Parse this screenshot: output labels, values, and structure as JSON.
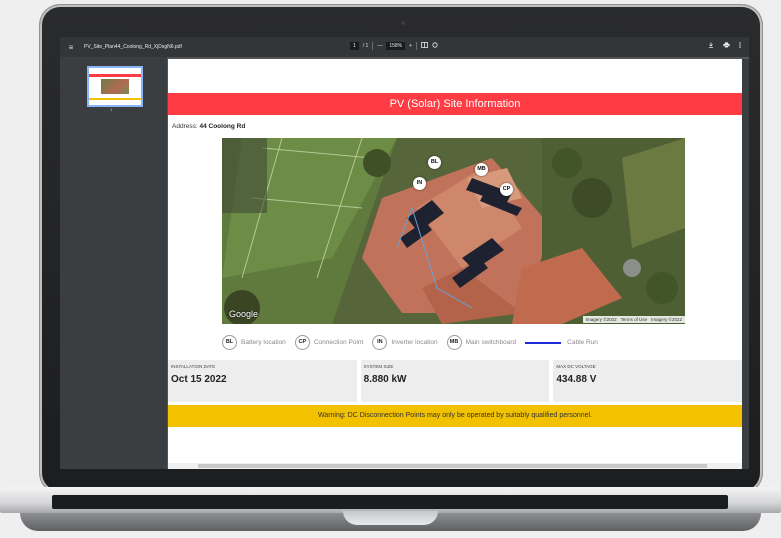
{
  "viewer": {
    "file_name": "PV_Site_Plan44_Coolong_Rd_XjDsgN6.pdf",
    "page_current": "1",
    "page_total": "/ 1",
    "zoom_minus": "—",
    "zoom_level": "158%",
    "zoom_plus": "+",
    "menu_icon": "≡",
    "thumbnail_page": "1",
    "icons": [
      "menu-icon",
      "fit-page-icon",
      "rotate-icon",
      "download-icon",
      "print-icon",
      "more-icon"
    ]
  },
  "document": {
    "title": "PV (Solar) Site Information",
    "address_label": "Address: ",
    "address_value": "44 Coolong Rd",
    "map": {
      "watermark": "Google",
      "attribution": [
        "Imagery ©2022",
        "Terms of Use",
        "Imagery ©2022"
      ],
      "pins": [
        "BL",
        "IN",
        "MB",
        "CP"
      ]
    },
    "legend": [
      {
        "code": "BL",
        "label": "Battery location"
      },
      {
        "code": "CP",
        "label": "Connection Point"
      },
      {
        "code": "IN",
        "label": "Inverter location"
      },
      {
        "code": "MB",
        "label": "Main switchboard"
      }
    ],
    "legend_line_label": "Cable Run",
    "stats": [
      {
        "label": "INSTALLATION DATE",
        "value": "Oct 15 2022"
      },
      {
        "label": "SYSTEM SIZE",
        "value": "8.880 kW"
      },
      {
        "label": "MAX DC VOLTAGE",
        "value": "434.88 V"
      }
    ],
    "warning": "Warning: DC Disconnection Points may only be operated by suitably qualified personnel."
  },
  "colors": {
    "banner": "#ff3b43",
    "warning": "#f2c200",
    "cable_run": "#1d2bd6",
    "toolbar": "#323639"
  }
}
